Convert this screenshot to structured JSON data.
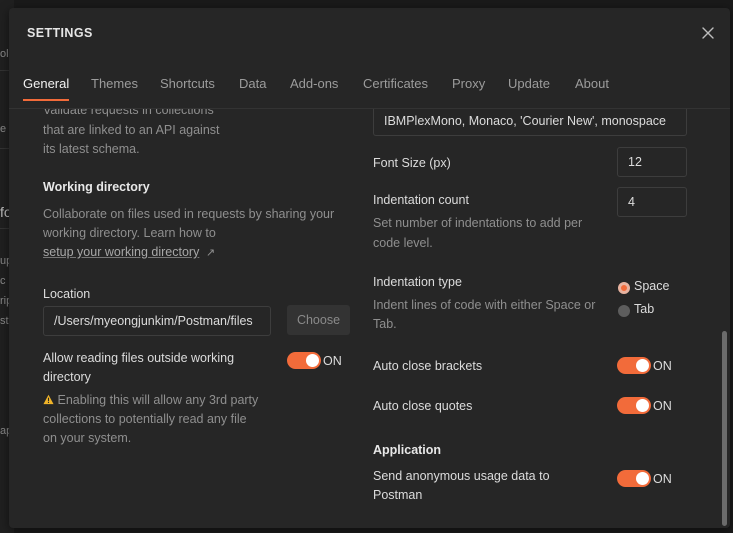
{
  "background": {
    "fragments": [
      "olle",
      "e c",
      "fo",
      "up",
      "c",
      "rip",
      "st",
      "apl"
    ]
  },
  "modal": {
    "title": "SETTINGS",
    "close_icon": "close-icon"
  },
  "tabs": [
    {
      "label": "General",
      "active": true
    },
    {
      "label": "Themes"
    },
    {
      "label": "Shortcuts"
    },
    {
      "label": "Data"
    },
    {
      "label": "Add-ons"
    },
    {
      "label": "Certificates"
    },
    {
      "label": "Proxy"
    },
    {
      "label": "Update"
    },
    {
      "label": "About"
    }
  ],
  "left": {
    "validate_desc_line1": "Validate requests in collections",
    "validate_desc_line2": "that are linked to an API against",
    "validate_desc_line3": "its latest schema.",
    "working_dir_heading": "Working directory",
    "working_dir_desc_line1": "Collaborate on files used in requests by sharing your",
    "working_dir_desc_line2": "working directory. Learn how to",
    "working_dir_link": "setup your working directory",
    "link_arrow": "↗",
    "location_label": "Location",
    "location_value": "/Users/myeongjunkim/Postman/files",
    "choose_button": "Choose",
    "allow_label_line1": "Allow reading files outside working",
    "allow_label_line2": "directory",
    "allow_toggle_state": "ON",
    "warning_line1": "Enabling this will allow any 3rd party",
    "warning_line2": "collections to potentially read any file",
    "warning_line3": "on your system.",
    "warning_icon": "warning-icon"
  },
  "right": {
    "font_family_value": "IBMPlexMono, Monaco, 'Courier New', monospace",
    "font_size_label": "Font Size (px)",
    "font_size_value": "12",
    "indent_count_label": "Indentation count",
    "indent_count_desc_line1": "Set number of indentations to add per",
    "indent_count_desc_line2": "code level.",
    "indent_count_value": "4",
    "indent_type_label": "Indentation type",
    "indent_type_desc_line1": "Indent lines of code with either Space or",
    "indent_type_desc_line2": "Tab.",
    "indent_option_space": "Space",
    "indent_option_tab": "Tab",
    "indent_selected": "Space",
    "auto_close_brackets_label": "Auto close brackets",
    "auto_close_brackets_state": "ON",
    "auto_close_quotes_label": "Auto close quotes",
    "auto_close_quotes_state": "ON",
    "application_heading": "Application",
    "usage_label_line1": "Send anonymous usage data to",
    "usage_label_line2": "Postman",
    "usage_state": "ON"
  },
  "colors": {
    "accent": "#f26b3a",
    "modal_bg": "#262626",
    "warning": "#f0b429"
  }
}
